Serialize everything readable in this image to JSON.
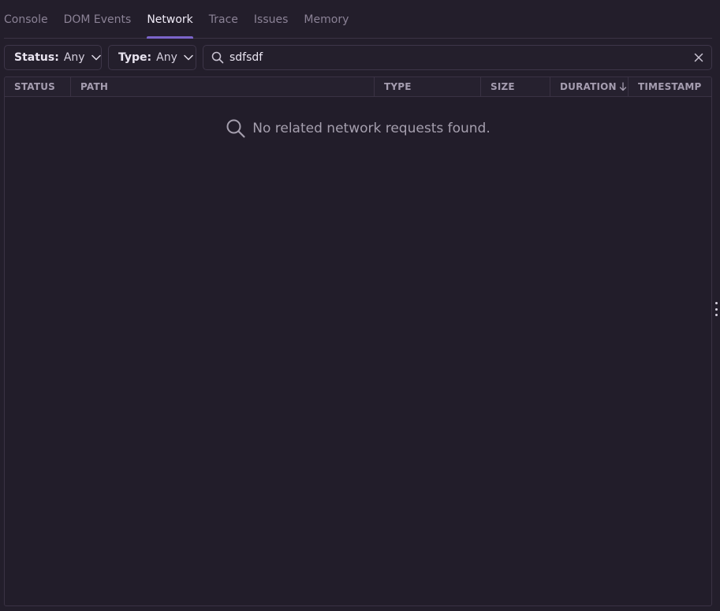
{
  "tabs": [
    {
      "label": "Console"
    },
    {
      "label": "DOM Events"
    },
    {
      "label": "Network",
      "active": true
    },
    {
      "label": "Trace"
    },
    {
      "label": "Issues"
    },
    {
      "label": "Memory"
    }
  ],
  "filters": {
    "status": {
      "label": "Status:",
      "value": "Any"
    },
    "type": {
      "label": "Type:",
      "value": "Any"
    }
  },
  "search": {
    "value": "sdfsdf",
    "icon": "search-icon",
    "clear_icon": "close-icon"
  },
  "table": {
    "columns": [
      {
        "label": "STATUS"
      },
      {
        "label": "PATH"
      },
      {
        "label": "TYPE"
      },
      {
        "label": "SIZE"
      },
      {
        "label": "DURATION",
        "sorted": "desc"
      },
      {
        "label": "TIMESTAMP"
      }
    ],
    "empty_message": "No related network requests found."
  },
  "colors": {
    "background": "#231e2b",
    "accent": "#7b64c9",
    "border": "#3a3244",
    "muted_text": "#8b8296"
  }
}
